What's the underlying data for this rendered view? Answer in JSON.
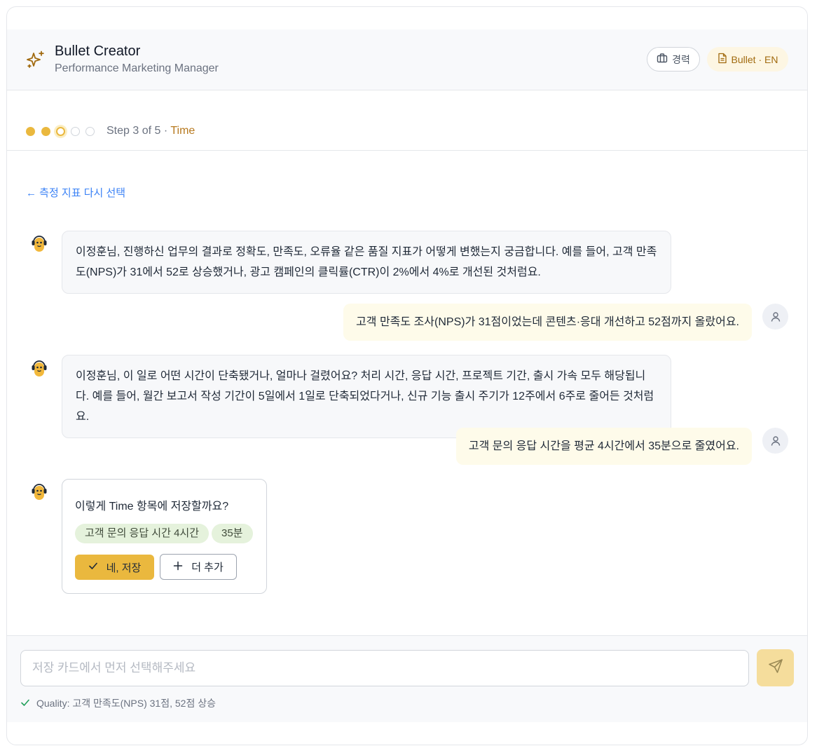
{
  "header": {
    "title": "Bullet Creator",
    "subtitle": "Performance Marketing Manager",
    "career_label": "경력",
    "lang_label": "Bullet · EN"
  },
  "progress": {
    "step_text": "Step 3 of 5 · ",
    "step_name": "Time",
    "current_step": 3,
    "total_steps": 5
  },
  "back_link": "← 측정 지표 다시 선택",
  "messages": [
    {
      "role": "bot",
      "text": "이정훈님, 진행하신 업무의 결과로 정확도, 만족도, 오류율 같은 품질 지표가 어떻게 변했는지 궁금합니다. 예를 들어, 고객 만족도(NPS)가 31에서 52로 상승했거나, 광고 캠페인의 클릭률(CTR)이 2%에서 4%로 개선된 것처럼요."
    },
    {
      "role": "user",
      "text": "고객 만족도 조사(NPS)가 31점이었는데 콘텐츠·응대 개선하고 52점까지 올랐어요."
    },
    {
      "role": "bot",
      "text": "이정훈님, 이 일로 어떤 시간이 단축됐거나, 얼마나 걸렸어요? 처리 시간, 응답 시간, 프로젝트 기간, 출시 가속 모두 해당됩니다. 예를 들어, 월간 보고서 작성 기간이 5일에서 1일로 단축되었다거나, 신규 기능 출시 주기가 12주에서 6주로 줄어든 것처럼요."
    },
    {
      "role": "user",
      "text": "고객 문의 응답 시간을 평균 4시간에서 35분으로 줄였어요."
    }
  ],
  "confirm": {
    "question": "이렇게 Time 항목에 저장할까요?",
    "chips": [
      "고객 문의 응답 시간 4시간",
      "35분"
    ],
    "yes_label": "네, 저장",
    "add_label": "더 추가"
  },
  "input": {
    "placeholder": "저장 카드에서 먼저 선택해주세요",
    "value": ""
  },
  "quality_note": "Quality: 고객 만족도(NPS) 31점, 52점 상승",
  "colors": {
    "accent": "#eab83e",
    "accent_text": "#b7791f",
    "link": "#3b82f6",
    "chip_bg": "#e5f2dc",
    "user_bubble": "#fefbea"
  },
  "icons": [
    "sparkle-icon",
    "briefcase-icon",
    "document-icon",
    "bot-avatar-icon",
    "user-icon",
    "check-icon",
    "plus-icon",
    "send-icon"
  ]
}
